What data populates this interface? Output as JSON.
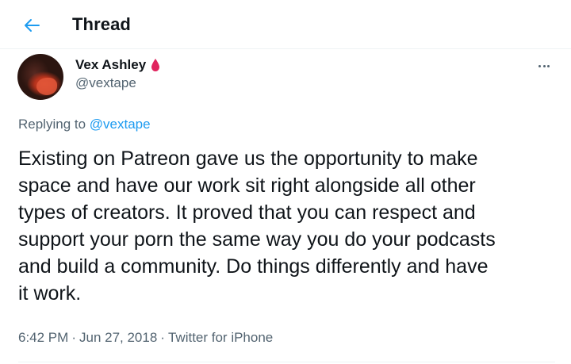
{
  "header": {
    "title": "Thread",
    "back_icon": "arrow-left-icon",
    "accent": "#1d9bf0"
  },
  "tweet": {
    "author": {
      "display_name": "Vex Ashley",
      "handle": "@vextape",
      "badge_icon": "blood-drop-icon",
      "badge_color": "#e0245e"
    },
    "more_icon": "more-horizontal-icon",
    "replying_prefix": "Replying to",
    "replying_handle": "@vextape",
    "text": "Existing on Patreon gave us the opportunity to make\nspace and have our work sit right alongside all other\ntypes of creators. It proved that you can respect and\nsupport your porn the same way you do your podcasts\nand build a community. Do things differently and have\nit work.",
    "time": "6:42 PM",
    "date": "Jun 27, 2018",
    "source": "Twitter for iPhone",
    "separator": "·"
  },
  "colors": {
    "text_primary": "#0f1419",
    "text_secondary": "#536471",
    "link": "#1d9bf0",
    "border": "#eff3f4"
  }
}
